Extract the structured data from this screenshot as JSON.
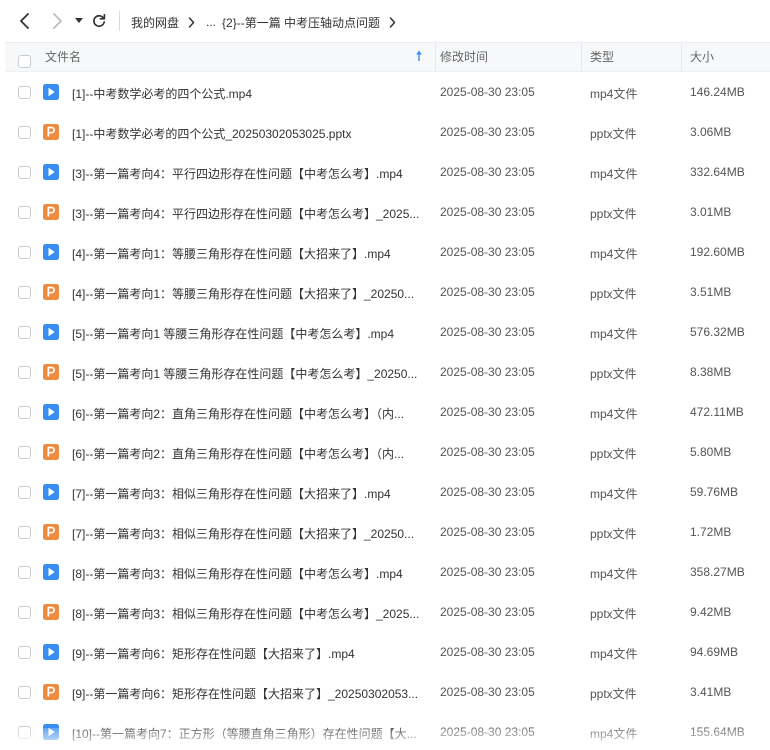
{
  "nav": {
    "back_icon": "chevron-left-icon",
    "forward_icon": "chevron-right-icon",
    "dropdown_icon": "caret-down-icon",
    "refresh_icon": "refresh-icon"
  },
  "breadcrumb": {
    "root": "我的网盘",
    "ellipsis": "...",
    "parent": "{2}--第一篇 中考压轴动点问题"
  },
  "table": {
    "headers": {
      "name": "文件名",
      "time": "修改时间",
      "type": "类型",
      "size": "大小"
    },
    "sort_icon": "sort-asc-arrow-icon",
    "colors": {
      "video_icon": "#3a8ef0",
      "pptx_icon": "#f08a3c",
      "header_bg": "#f7f8fa"
    },
    "rows": [
      {
        "icon": "video",
        "name": "[1]--中考数学必考的四个公式.mp4",
        "time": "2025-08-30 23:05",
        "type": "mp4文件",
        "size": "146.24MB"
      },
      {
        "icon": "pptx",
        "name": "[1]--中考数学必考的四个公式_20250302053025.pptx",
        "time": "2025-08-30 23:05",
        "type": "pptx文件",
        "size": "3.06MB"
      },
      {
        "icon": "video",
        "name": "[3]--第一篇考向4：平行四边形存在性问题【中考怎么考】.mp4",
        "time": "2025-08-30 23:05",
        "type": "mp4文件",
        "size": "332.64MB"
      },
      {
        "icon": "pptx",
        "name": "[3]--第一篇考向4：平行四边形存在性问题【中考怎么考】_2025...",
        "time": "2025-08-30 23:05",
        "type": "pptx文件",
        "size": "3.01MB"
      },
      {
        "icon": "video",
        "name": "[4]--第一篇考向1：等腰三角形存在性问题【大招来了】.mp4",
        "time": "2025-08-30 23:05",
        "type": "mp4文件",
        "size": "192.60MB"
      },
      {
        "icon": "pptx",
        "name": "[4]--第一篇考向1：等腰三角形存在性问题【大招来了】_20250...",
        "time": "2025-08-30 23:05",
        "type": "pptx文件",
        "size": "3.51MB"
      },
      {
        "icon": "video",
        "name": "[5]--第一篇考向1 等腰三角形存在性问题【中考怎么考】.mp4",
        "time": "2025-08-30 23:05",
        "type": "mp4文件",
        "size": "576.32MB"
      },
      {
        "icon": "pptx",
        "name": "[5]--第一篇考向1 等腰三角形存在性问题【中考怎么考】_20250...",
        "time": "2025-08-30 23:05",
        "type": "pptx文件",
        "size": "8.38MB"
      },
      {
        "icon": "video",
        "name": "[6]--第一篇考向2：直角三角形存在性问题【中考怎么考】（内...",
        "time": "2025-08-30 23:05",
        "type": "mp4文件",
        "size": "472.11MB"
      },
      {
        "icon": "pptx",
        "name": "[6]--第一篇考向2：直角三角形存在性问题【中考怎么考】（内...",
        "time": "2025-08-30 23:05",
        "type": "pptx文件",
        "size": "5.80MB"
      },
      {
        "icon": "video",
        "name": "[7]--第一篇考向3：相似三角形存在性问题【大招来了】.mp4",
        "time": "2025-08-30 23:05",
        "type": "mp4文件",
        "size": "59.76MB"
      },
      {
        "icon": "pptx",
        "name": "[7]--第一篇考向3：相似三角形存在性问题【大招来了】_20250...",
        "time": "2025-08-30 23:05",
        "type": "pptx文件",
        "size": "1.72MB"
      },
      {
        "icon": "video",
        "name": "[8]--第一篇考向3：相似三角形存在性问题【中考怎么考】.mp4",
        "time": "2025-08-30 23:05",
        "type": "mp4文件",
        "size": "358.27MB"
      },
      {
        "icon": "pptx",
        "name": "[8]--第一篇考向3：相似三角形存在性问题【中考怎么考】_2025...",
        "time": "2025-08-30 23:05",
        "type": "pptx文件",
        "size": "9.42MB"
      },
      {
        "icon": "video",
        "name": "[9]--第一篇考向6：矩形存在性问题【大招来了】.mp4",
        "time": "2025-08-30 23:05",
        "type": "mp4文件",
        "size": "94.69MB"
      },
      {
        "icon": "pptx",
        "name": "[9]--第一篇考向6：矩形存在性问题【大招来了】_20250302053...",
        "time": "2025-08-30 23:05",
        "type": "pptx文件",
        "size": "3.41MB"
      },
      {
        "icon": "video",
        "name": "[10]--第一篇考向7：正方形（等腰直角三角形）存在性问题【大...",
        "time": "2025-08-30 23:05",
        "type": "mp4文件",
        "size": "155.64MB"
      }
    ]
  }
}
